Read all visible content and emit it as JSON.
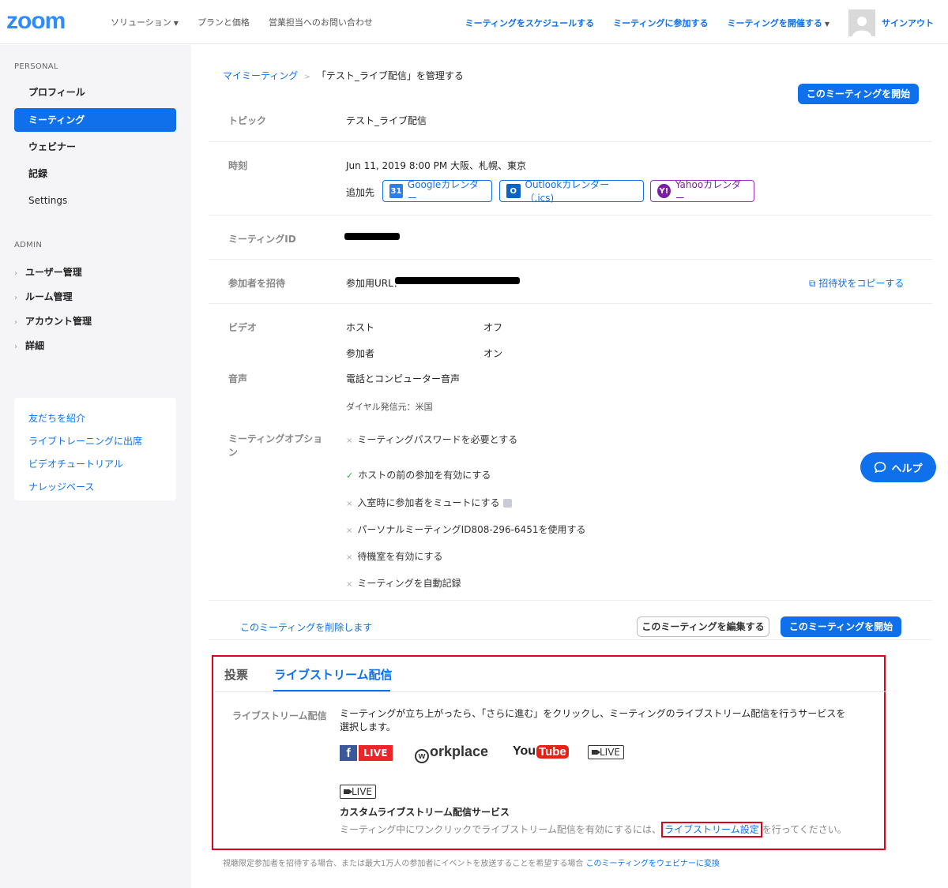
{
  "header": {
    "logo": "zoom",
    "nav_left": [
      "ソリューション",
      "プランと価格",
      "営業担当へのお問い合わせ"
    ],
    "nav_right": [
      "ミーティングをスケジュールする",
      "ミーティングに参加する",
      "ミーティングを開催する"
    ],
    "signout": "サインアウト"
  },
  "sidebar": {
    "personal_label": "PERSONAL",
    "personal_items": [
      "プロフィール",
      "ミーティング",
      "ウェビナー",
      "記録",
      "Settings"
    ],
    "admin_label": "ADMIN",
    "admin_items": [
      "ユーザー管理",
      "ルーム管理",
      "アカウント管理",
      "詳細"
    ],
    "links": [
      "友だちを紹介",
      "ライブトレーニングに出席",
      "ビデオチュートリアル",
      "ナレッジベース"
    ]
  },
  "breadcrumb": {
    "root": "マイミーティング",
    "sep": ">",
    "current": "「テスト_ライブ配信」を管理する"
  },
  "start_button": "このミーティングを開始",
  "rows": {
    "topic_label": "トピック",
    "topic_value": "テスト_ライブ配信",
    "time_label": "時刻",
    "time_value": "Jun 11, 2019 8:00 PM 大阪、札幌、東京",
    "add_to_label": "追加先",
    "cal_google": "Googleカレンダー",
    "cal_google_icon": "31",
    "cal_outlook": "Outlookカレンダー（.ics)",
    "cal_outlook_icon": "O",
    "cal_yahoo": "Yahooカレンダー",
    "cal_yahoo_icon": "Y!",
    "meeting_id_label": "ミーティングID",
    "invite_label": "参加者を招待",
    "join_url_label": "参加用URL：",
    "copy_invite": "招待状をコピーする",
    "video_label": "ビデオ",
    "host_label": "ホスト",
    "host_value": "オフ",
    "participant_label": "参加者",
    "participant_value": "オン",
    "audio_label": "音声",
    "audio_value": "電話とコンピューター音声",
    "dial_from": "ダイヤル発信元：米国",
    "options_label": "ミーティングオプション",
    "options": [
      {
        "mark": "×",
        "text": "ミーティングパスワードを必要とする"
      },
      {
        "mark": "✓",
        "text": "ホストの前の参加を有効にする"
      },
      {
        "mark": "×",
        "text": "入室時に参加者をミュートにする"
      },
      {
        "mark": "×",
        "text": "パーソナルミーティングID808-296-6451を使用する"
      },
      {
        "mark": "×",
        "text": "待機室を有効にする"
      },
      {
        "mark": "×",
        "text": "ミーティングを自動記録"
      }
    ]
  },
  "actions": {
    "delete": "このミーティングを削除します",
    "edit": "このミーティングを編集する",
    "start": "このミーティングを開始"
  },
  "help": "ヘルプ",
  "livestream": {
    "tab_poll": "投票",
    "tab_live": "ライブストリーム配信",
    "label": "ライブストリーム配信",
    "desc": "ミーティングが立ち上がったら、「さらに進む」をクリックし、ミーティングのライブストリーム配信を行うサービスを選択します。",
    "fb_letter": "f",
    "fb_live": "LIVE",
    "workplace": "orkplace",
    "workplace_mark": "w",
    "yt_you": "You",
    "yt_tube": "Tube",
    "cam_live": "LIVE",
    "custom_title": "カスタムライブストリーム配信サービス",
    "note_pre": "ミーティング中にワンクリックでライブストリーム配信を有効にするには、",
    "note_link": "ライブストリーム設定",
    "note_post": "を行ってください。"
  },
  "footnote": {
    "text": "視聴限定参加者を招待する場合、または最大1万人の参加者にイベントを放送することを希望する場合",
    "link": "このミーティングをウェビナーに変換"
  },
  "colors": {
    "brand": "#0e71eb",
    "highlight": "#e0001b",
    "sidebar_bg": "#f5f5f7"
  }
}
